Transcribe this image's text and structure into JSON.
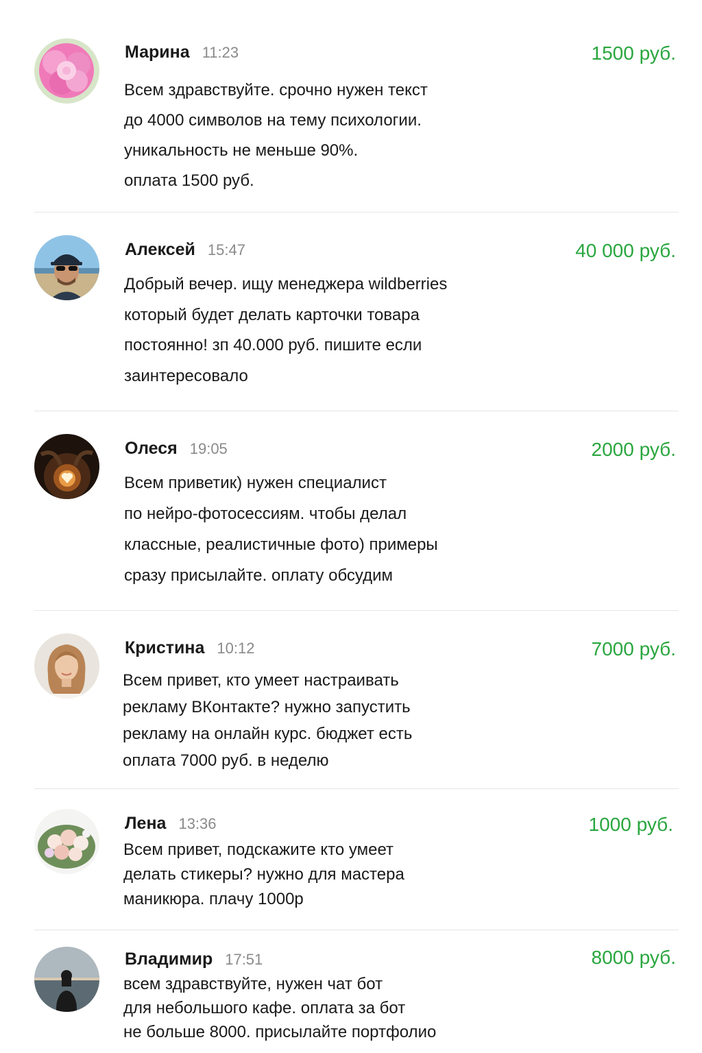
{
  "messages": [
    {
      "name": "Марина",
      "time": "11:23",
      "price": "1500 руб.",
      "avatar": "peony-flower-avatar",
      "lines": [
        "Всем здравствуйте. срочно нужен текст",
        "до 4000 символов на тему психологии.",
        "уникальность не меньше 90%.",
        "оплата 1500 руб."
      ]
    },
    {
      "name": "Алексей",
      "time": "15:47",
      "price": "40 000 руб.",
      "avatar": "man-in-cap-avatar",
      "lines": [
        "Добрый вечер. ищу менеджера wildberries",
        "который будет делать карточки товара",
        "постоянно! зп 40.000 руб. пишите если",
        "заинтересовало"
      ]
    },
    {
      "name": "Олеся",
      "time": "19:05",
      "price": "2000 руб.",
      "avatar": "heart-candle-avatar",
      "lines": [
        "Всем приветик) нужен специалист",
        "по нейро-фотосессиям. чтобы делал",
        "классные, реалистичные фото) примеры",
        "сразу присылайте. оплату обсудим"
      ]
    },
    {
      "name": "Кристина",
      "time": "10:12",
      "price": "7000 руб.",
      "avatar": "woman-portrait-avatar",
      "lines": [
        "Всем привет, кто умеет настраивать",
        "рекламу ВКонтакте? нужно запустить",
        "рекламу на онлайн курс. бюджет есть",
        "оплата 7000 руб. в неделю"
      ]
    },
    {
      "name": "Лена",
      "time": "13:36",
      "price": "1000 руб.",
      "avatar": "rose-bouquet-avatar",
      "lines": [
        "Всем привет, подскажите кто умеет",
        "делать стикеры? нужно для мастера",
        "маникюра. плачу 1000р"
      ]
    },
    {
      "name": "Владимир",
      "time": "17:51",
      "price": "8000 руб.",
      "avatar": "sea-silhouette-avatar",
      "lines": [
        "всем здравствуйте, нужен чат бот",
        "для небольшого кафе. оплата за бот",
        "не больше 8000. присылайте портфолио"
      ]
    }
  ]
}
